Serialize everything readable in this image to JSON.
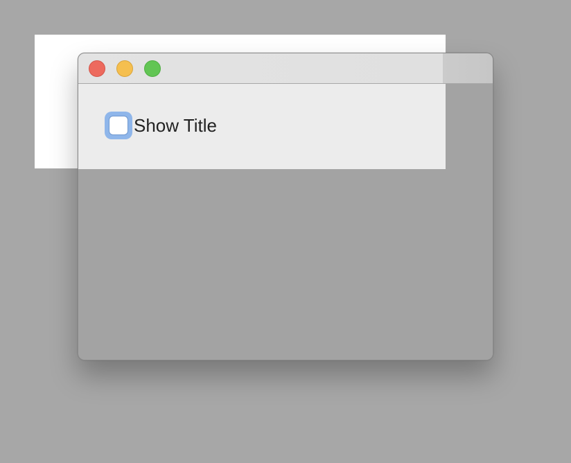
{
  "window": {
    "controls": {
      "close": "close-button",
      "minimize": "minimize-button",
      "zoom": "zoom-button"
    }
  },
  "content": {
    "show_title_checkbox": {
      "label": "Show Title",
      "checked": false
    }
  },
  "colors": {
    "desktop": "#a7a7a7",
    "content_background": "#ececec",
    "focus_ring": "#8fb6ea",
    "close": "#ed6a5e",
    "minimize": "#f5bf4f",
    "zoom": "#62c554"
  }
}
